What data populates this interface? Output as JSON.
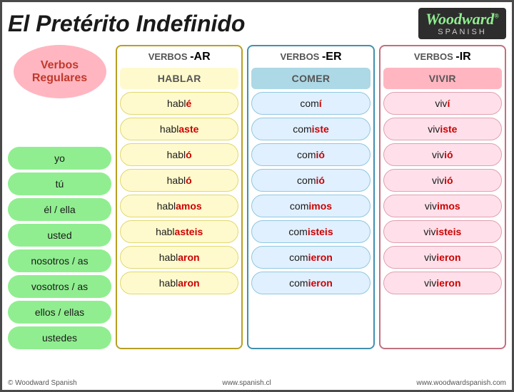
{
  "header": {
    "title": "El Pretérito Indefinido",
    "logo_brand": "Woodward",
    "logo_reg": "®",
    "logo_sub": "SPANISH"
  },
  "verbos_regulares": "Verbos\nRegulares",
  "columns": [
    {
      "id": "ar",
      "label_prefix": "VERBOS",
      "label_suffix": "-AR",
      "example": "HABLAR",
      "conjugations": [
        {
          "stem": "habl",
          "ending": "é"
        },
        {
          "stem": "habl",
          "ending": "aste"
        },
        {
          "stem": "habl",
          "ending": "ó"
        },
        {
          "stem": "habl",
          "ending": "ó"
        },
        {
          "stem": "habl",
          "ending": "amos"
        },
        {
          "stem": "habl",
          "ending": "asteis"
        },
        {
          "stem": "habl",
          "ending": "aron"
        },
        {
          "stem": "habl",
          "ending": "aron"
        }
      ]
    },
    {
      "id": "er",
      "label_prefix": "VERBOS",
      "label_suffix": "-ER",
      "example": "COMER",
      "conjugations": [
        {
          "stem": "com",
          "ending": "í"
        },
        {
          "stem": "com",
          "ending": "iste"
        },
        {
          "stem": "com",
          "ending": "ió"
        },
        {
          "stem": "com",
          "ending": "ió"
        },
        {
          "stem": "com",
          "ending": "imos"
        },
        {
          "stem": "com",
          "ending": "isteis"
        },
        {
          "stem": "com",
          "ending": "ieron"
        },
        {
          "stem": "com",
          "ending": "ieron"
        }
      ]
    },
    {
      "id": "ir",
      "label_prefix": "VERBOS",
      "label_suffix": "-IR",
      "example": "VIVIR",
      "conjugations": [
        {
          "stem": "viv",
          "ending": "í"
        },
        {
          "stem": "viv",
          "ending": "iste"
        },
        {
          "stem": "viv",
          "ending": "ió"
        },
        {
          "stem": "viv",
          "ending": "ió"
        },
        {
          "stem": "viv",
          "ending": "imos"
        },
        {
          "stem": "viv",
          "ending": "isteis"
        },
        {
          "stem": "viv",
          "ending": "ieron"
        },
        {
          "stem": "viv",
          "ending": "ieron"
        }
      ]
    }
  ],
  "pronouns": [
    "yo",
    "tú",
    "él / ella",
    "usted",
    "nosotros / as",
    "vosotros / as",
    "ellos / ellas",
    "ustedes"
  ],
  "footer": {
    "left": "© Woodward Spanish",
    "center": "www.spanish.cl",
    "right": "www.woodwardspanish.com"
  }
}
